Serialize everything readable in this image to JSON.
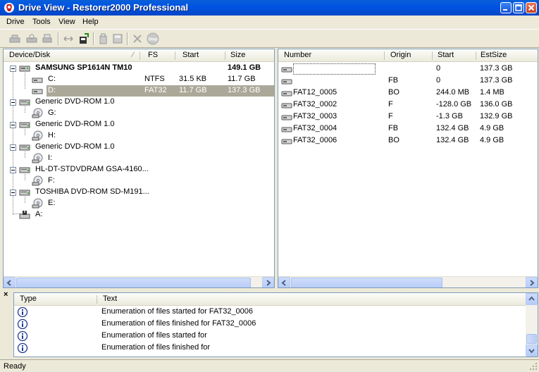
{
  "window": {
    "title": "Drive View - Restorer2000 Professional"
  },
  "menu": [
    "Drive",
    "Tools",
    "View",
    "Help"
  ],
  "toolbar": {
    "icons": [
      "open-drive-icon",
      "scan-icon",
      "print-icon",
      "compare-icon",
      "export-icon",
      "copy-icon",
      "save-icon",
      "cancel-icon",
      "stop-icon"
    ],
    "stop_label": "Stop"
  },
  "left": {
    "columns": [
      "Device/Disk",
      "FS",
      "Start",
      "Size"
    ],
    "rows": [
      {
        "name": "SAMSUNG SP1614N TM10",
        "fs": "",
        "start": "",
        "size": "149.1 GB",
        "level": 0,
        "bold": true,
        "type": "hdd"
      },
      {
        "name": "C:",
        "fs": "NTFS",
        "start": "31.5 KB",
        "size": "11.7 GB",
        "level": 1,
        "type": "partition"
      },
      {
        "name": "D:",
        "fs": "FAT32",
        "start": "11.7 GB",
        "size": "137.3 GB",
        "level": 1,
        "type": "partition",
        "selected": true
      },
      {
        "name": "Generic DVD-ROM 1.0",
        "fs": "",
        "start": "",
        "size": "",
        "level": 0,
        "type": "cdrom"
      },
      {
        "name": "G:",
        "fs": "",
        "start": "",
        "size": "",
        "level": 1,
        "type": "disc"
      },
      {
        "name": "Generic DVD-ROM 1.0",
        "fs": "",
        "start": "",
        "size": "",
        "level": 0,
        "type": "cdrom"
      },
      {
        "name": "H:",
        "fs": "",
        "start": "",
        "size": "",
        "level": 1,
        "type": "disc"
      },
      {
        "name": "Generic DVD-ROM 1.0",
        "fs": "",
        "start": "",
        "size": "",
        "level": 0,
        "type": "cdrom"
      },
      {
        "name": "I:",
        "fs": "",
        "start": "",
        "size": "",
        "level": 1,
        "type": "disc"
      },
      {
        "name": "HL-DT-STDVDRAM GSA-4160...",
        "fs": "",
        "start": "",
        "size": "",
        "level": 0,
        "type": "cdrom"
      },
      {
        "name": "F:",
        "fs": "",
        "start": "",
        "size": "",
        "level": 1,
        "type": "disc"
      },
      {
        "name": "TOSHIBA DVD-ROM SD-M191...",
        "fs": "",
        "start": "",
        "size": "",
        "level": 0,
        "type": "cdrom"
      },
      {
        "name": "E:",
        "fs": "",
        "start": "",
        "size": "",
        "level": 1,
        "type": "disc"
      },
      {
        "name": "A:",
        "fs": "",
        "start": "",
        "size": "",
        "level": 0,
        "type": "floppy"
      }
    ]
  },
  "right": {
    "columns": [
      "Number",
      "Origin",
      "Start",
      "EstSize"
    ],
    "rows": [
      {
        "number": "",
        "origin": "",
        "start": "0",
        "estsize": "137.3 GB"
      },
      {
        "number": "",
        "origin": "FB",
        "start": "0",
        "estsize": "137.3 GB"
      },
      {
        "number": "FAT12_0005",
        "origin": "BO",
        "start": "244.0 MB",
        "estsize": "1.4 MB"
      },
      {
        "number": "FAT32_0002",
        "origin": "F",
        "start": "-128.0 GB",
        "estsize": "136.0 GB"
      },
      {
        "number": "FAT32_0003",
        "origin": "F",
        "start": "-1.3 GB",
        "estsize": "132.9 GB"
      },
      {
        "number": "FAT32_0004",
        "origin": "FB",
        "start": "132.4 GB",
        "estsize": "4.9 GB"
      },
      {
        "number": "FAT32_0006",
        "origin": "BO",
        "start": "132.4 GB",
        "estsize": "4.9 GB"
      }
    ]
  },
  "log": {
    "close_glyph": "×",
    "columns": [
      "Type",
      "Text"
    ],
    "rows": [
      {
        "type": "info",
        "text": "Enumeration of files started for FAT32_0006"
      },
      {
        "type": "info",
        "text": "Enumeration of files finished for FAT32_0006"
      },
      {
        "type": "info",
        "text": "Enumeration of files started for"
      },
      {
        "type": "info",
        "text": "Enumeration of files finished for"
      }
    ]
  },
  "status": {
    "text": "Ready"
  }
}
